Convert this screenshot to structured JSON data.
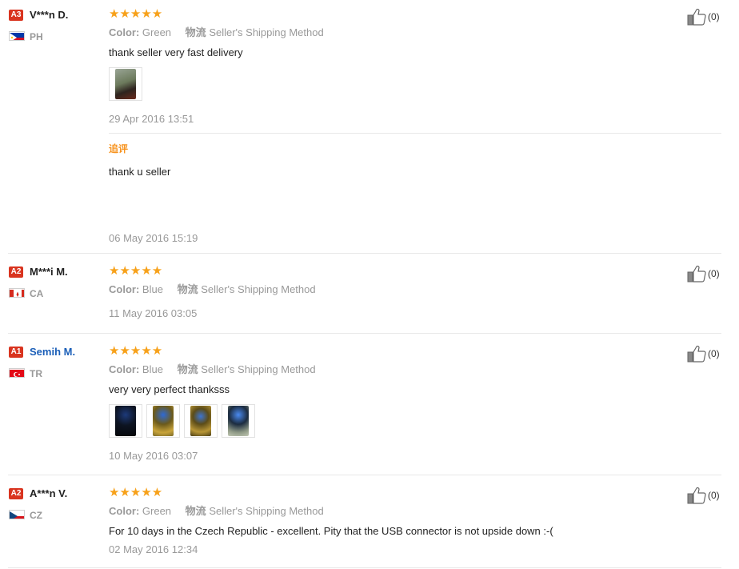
{
  "reviews": [
    {
      "level": "A3",
      "name": "V***n D.",
      "country": "PH",
      "stars": "★★★★★",
      "color_label": "Color:",
      "color_value": "Green",
      "shipping_icon_text": "物流",
      "shipping_method": "Seller's Shipping Method",
      "text": "thank seller very fast delivery",
      "date": "29 Apr 2016 13:51",
      "followup_label": "追评",
      "followup_text": "thank u seller",
      "followup_date": "06 May 2016 15:19",
      "likes": "(0)"
    },
    {
      "level": "A2",
      "name": "M***i M.",
      "country": "CA",
      "stars": "★★★★★",
      "color_label": "Color:",
      "color_value": "Blue",
      "shipping_icon_text": "物流",
      "shipping_method": "Seller's Shipping Method",
      "date": "11 May 2016 03:05",
      "likes": "(0)"
    },
    {
      "level": "A1",
      "name": "Semih M.",
      "country": "TR",
      "stars": "★★★★★",
      "color_label": "Color:",
      "color_value": "Blue",
      "shipping_icon_text": "物流",
      "shipping_method": "Seller's Shipping Method",
      "text": "very very perfect thanksss",
      "date": "10 May 2016 03:07",
      "likes": "(0)"
    },
    {
      "level": "A2",
      "name": "A***n V.",
      "country": "CZ",
      "stars": "★★★★★",
      "color_label": "Color:",
      "color_value": "Green",
      "shipping_icon_text": "物流",
      "shipping_method": "Seller's Shipping Method",
      "text": "For 10 days in the Czech Republic - excellent. Pity that the USB connector is not upside down :-(",
      "date": "02 May 2016 12:34",
      "likes": "(0)"
    }
  ],
  "colors": {
    "level_badge": "#d9341f",
    "stars": "#f7a11a",
    "followup_label": "#f7931e",
    "muted_text": "#999999",
    "link_name": "#1b5fb8"
  }
}
